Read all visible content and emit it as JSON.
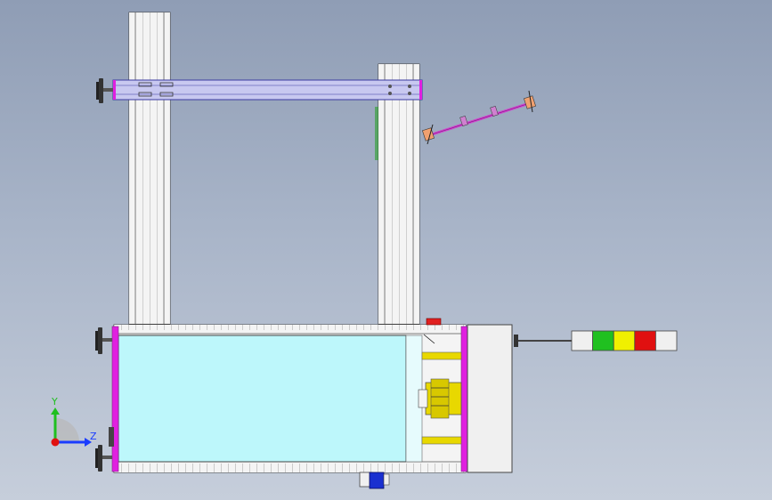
{
  "viewport": {
    "background_top": "#8f9db5",
    "background_bottom": "#c6cedb"
  },
  "triad": {
    "x_label": "Z",
    "y_label": "Y",
    "x_color": "#1a3cff",
    "y_color": "#1fbf1f",
    "origin_color": "#e01010"
  },
  "colors": {
    "frame_edge": "#444444",
    "column_fill": "#f2f2f2",
    "beam_fill": "#c8c8f0",
    "beam_edge": "#3a3aa0",
    "plate_magenta": "#e020e0",
    "tank_fill": "#bdf7fb",
    "brass": "#e8d800",
    "panel_fill": "#f0f0f0",
    "button_red": "#e02020",
    "motor_blue": "#1a30d0",
    "rod_magenta": "#d040d0",
    "nut_orange": "#f0a070",
    "foot_dark": "#333333"
  },
  "tower_light": {
    "segments": [
      "#f0f0f0",
      "#20c020",
      "#f0f000",
      "#e01010",
      "#f0f0f0"
    ]
  }
}
